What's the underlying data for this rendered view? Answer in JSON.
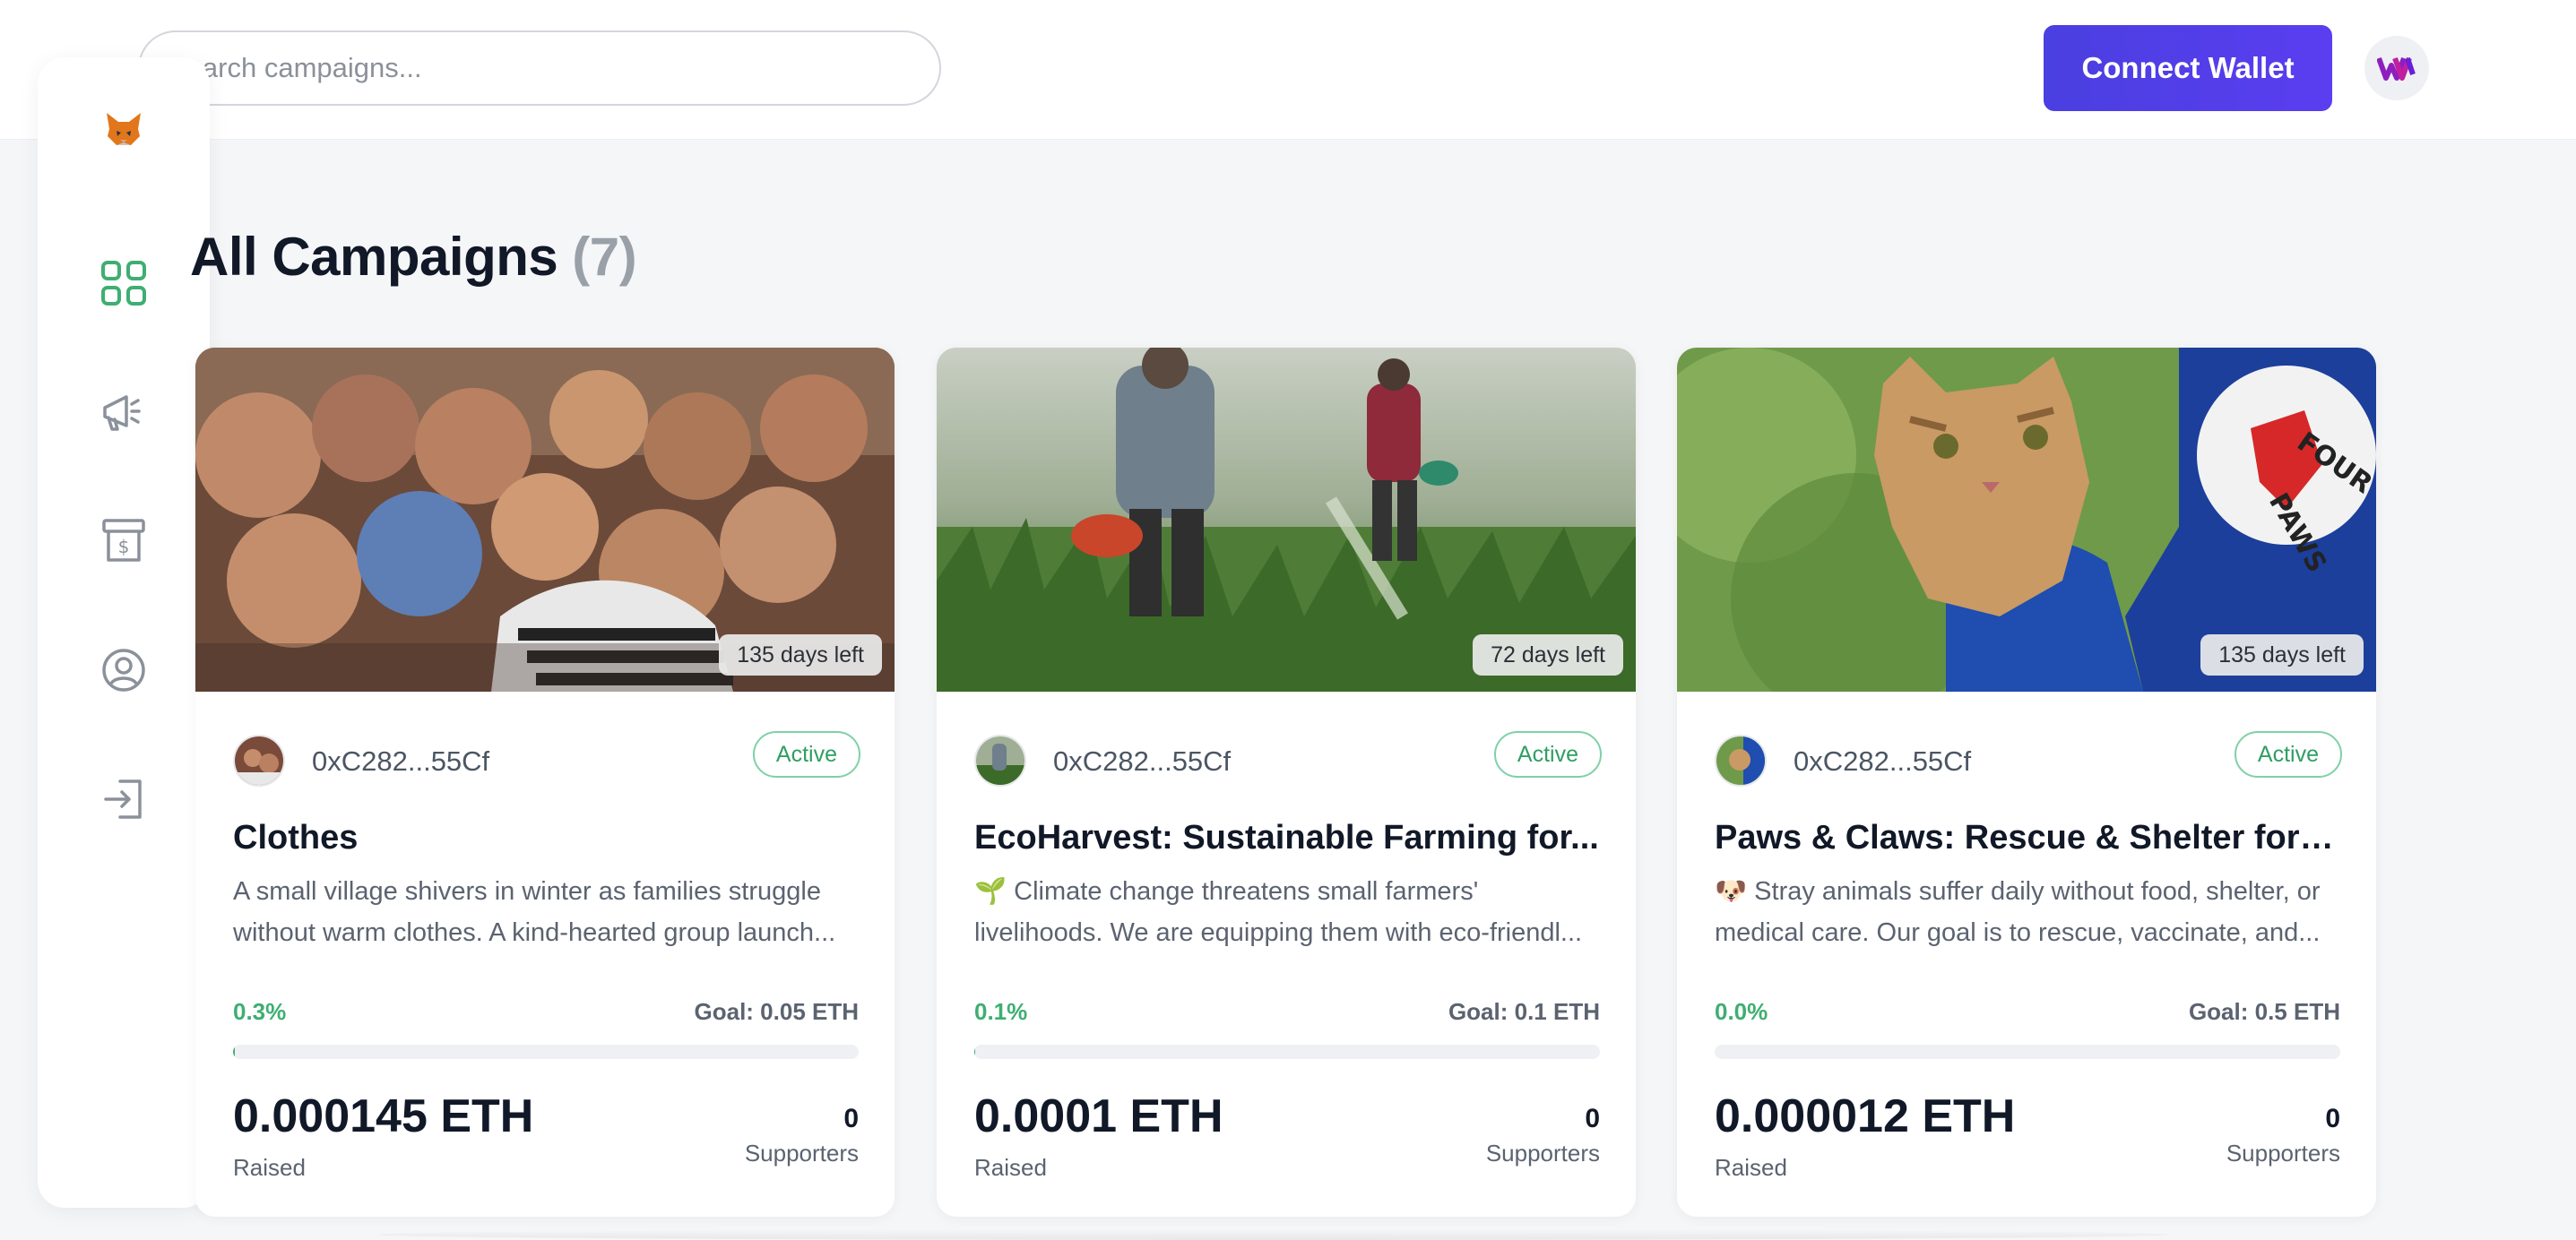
{
  "search": {
    "placeholder": "Search campaigns..."
  },
  "header": {
    "connect_label": "Connect Wallet",
    "brand_icon": "w-logo-icon"
  },
  "colors": {
    "accent": "#4a3fe0",
    "green": "#3fae72",
    "active_border": "#7fd1a7"
  },
  "sidebar": {
    "logo_icon": "fox-logo-icon",
    "items": [
      {
        "name": "dashboard",
        "icon": "grid-icon",
        "active": true
      },
      {
        "name": "campaign",
        "icon": "megaphone-icon",
        "active": false
      },
      {
        "name": "withdraw",
        "icon": "payment-icon",
        "active": false
      },
      {
        "name": "profile",
        "icon": "user-icon",
        "active": false
      },
      {
        "name": "logout",
        "icon": "logout-icon",
        "active": false
      }
    ]
  },
  "page": {
    "title": "All Campaigns",
    "count": "(7)"
  },
  "campaigns": [
    {
      "days_left": "135 days left",
      "creator": "0xC282...55Cf",
      "status": "Active",
      "title": "Clothes",
      "description": "A small village shivers in winter as families struggle without warm clothes. A kind-hearted group launch...",
      "percent": "0.3%",
      "progress": 0.003,
      "goal": "Goal: 0.05 ETH",
      "raised": "0.000145 ETH",
      "raised_label": "Raised",
      "supporters": "0",
      "supporters_label": "Supporters"
    },
    {
      "days_left": "72 days left",
      "creator": "0xC282...55Cf",
      "status": "Active",
      "title": "EcoHarvest: Sustainable Farming for...",
      "description": "🌱 Climate change threatens small farmers' livelihoods. We are equipping them with eco-friendl...",
      "percent": "0.1%",
      "progress": 0.001,
      "goal": "Goal: 0.1 ETH",
      "raised": "0.0001 ETH",
      "raised_label": "Raised",
      "supporters": "0",
      "supporters_label": "Supporters"
    },
    {
      "days_left": "135 days left",
      "creator": "0xC282...55Cf",
      "status": "Active",
      "title": "Paws & Claws: Rescue & Shelter for Str...",
      "description": "🐶 Stray animals suffer daily without food, shelter, or medical care. Our goal is to rescue, vaccinate, and...",
      "percent": "0.0%",
      "progress": 0.0,
      "goal": "Goal: 0.5 ETH",
      "raised": "0.000012 ETH",
      "raised_label": "Raised",
      "supporters": "0",
      "supporters_label": "Supporters"
    }
  ]
}
